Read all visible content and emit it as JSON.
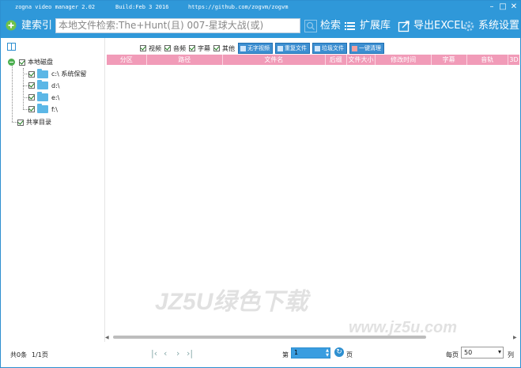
{
  "titlebar": {
    "app_name": "zogna video manager 2.02",
    "build": "Build:Feb  3 2016",
    "url": "https://github.com/zogvm/zogvm"
  },
  "toolbar": {
    "build_index_label": "建索引",
    "search_placeholder": "本地文件检索:The+Hunt(且) 007-星球大战(或)",
    "search_label": "检索",
    "extension_label": "扩展库",
    "export_label": "导出EXCEL",
    "settings_label": "系统设置"
  },
  "tree": {
    "root_label": "本地磁盘",
    "drives": [
      {
        "label": "c:\\ 系统保留"
      },
      {
        "label": "d:\\"
      },
      {
        "label": "e:\\"
      },
      {
        "label": "f:\\"
      }
    ],
    "shared_label": "共享目录"
  },
  "filters": {
    "checkboxes": [
      {
        "label": "视频"
      },
      {
        "label": "音频"
      },
      {
        "label": "字幕"
      },
      {
        "label": "其他"
      }
    ],
    "buttons": [
      {
        "label": "无字视频"
      },
      {
        "label": "重复文件"
      },
      {
        "label": "垃圾文件"
      },
      {
        "label": "一键清理"
      }
    ]
  },
  "grid": {
    "columns": [
      "分区",
      "路径",
      "文件名",
      "后缀",
      "文件大小",
      "修改时间",
      "字幕",
      "音轨",
      "3D"
    ]
  },
  "status": {
    "total": "共0条",
    "pages": "1/1页",
    "page_prefix": "第",
    "page_value": "1",
    "page_suffix": "页",
    "per_page_label": "每页",
    "per_page_value": "50",
    "per_page_unit": "列"
  },
  "watermark": {
    "main": "JZ5U绿色下载",
    "sub": "www.jz5u.com"
  },
  "colors": {
    "titlebar": "#2f98d9",
    "header": "#f19bb8",
    "button": "#3d8fd1"
  }
}
